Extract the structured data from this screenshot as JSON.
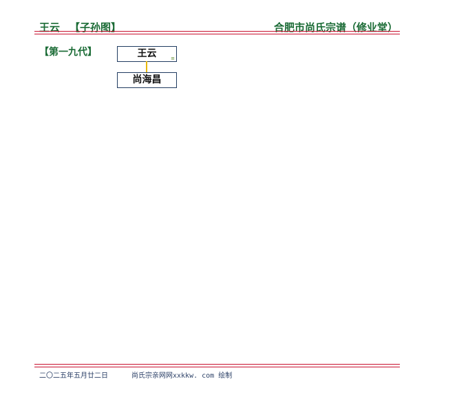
{
  "header": {
    "person_name": "王云",
    "chart_kind": "【子孙图】",
    "genealogy_title": "合肥市尚氏宗谱（修业堂）"
  },
  "generation": {
    "label": "【第一九代】"
  },
  "tree": {
    "root": {
      "name": "王云",
      "mark": "≡"
    },
    "child": {
      "name": "尚海昌"
    }
  },
  "footer": {
    "date": "二〇二五年五月廿二日",
    "credit": "尚氏宗亲网网xxkkw. com 绘制"
  },
  "colors": {
    "title_green": "#1a6b35",
    "rule_red": "#c8102e",
    "box_border": "#1f3a5f",
    "connector": "#e8b800",
    "footer_text": "#2a3f66"
  }
}
